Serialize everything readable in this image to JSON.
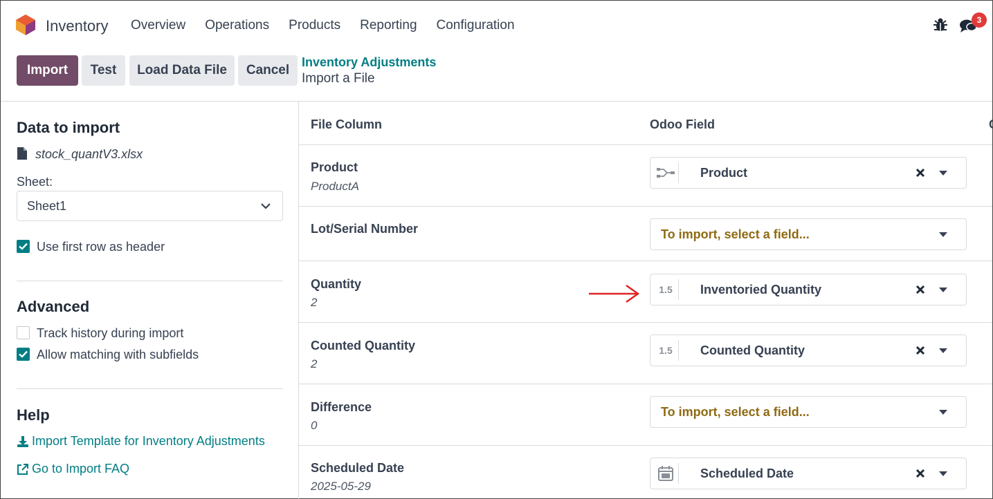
{
  "app": {
    "name": "Inventory",
    "menu": [
      "Overview",
      "Operations",
      "Products",
      "Reporting",
      "Configuration"
    ],
    "notifications": "3"
  },
  "actions": {
    "import": "Import",
    "test": "Test",
    "load": "Load Data File",
    "cancel": "Cancel"
  },
  "breadcrumb": {
    "parent": "Inventory Adjustments",
    "current": "Import a File"
  },
  "sidebar": {
    "data_title": "Data to import",
    "file_name": "stock_quantV3.xlsx",
    "sheet_label": "Sheet:",
    "sheet_value": "Sheet1",
    "header_option": "Use first row as header",
    "advanced_title": "Advanced",
    "track_history": "Track history during import",
    "allow_matching": "Allow matching with subfields",
    "help_title": "Help",
    "template_link": "Import Template for Inventory Adjustments",
    "faq_link": "Go to Import FAQ"
  },
  "table": {
    "col_file": "File Column",
    "col_odoo": "Odoo Field",
    "col_third": "C",
    "placeholder": "To import, select a field...",
    "rows": [
      {
        "name": "Product",
        "sample": "ProductA",
        "field": "Product",
        "icon": "relation-icon"
      },
      {
        "name": "Lot/Serial Number",
        "sample": "",
        "field": "",
        "icon": ""
      },
      {
        "name": "Quantity",
        "sample": "2",
        "field": "Inventoried Quantity",
        "icon": "decimal-icon",
        "icon_text": "1.5"
      },
      {
        "name": "Counted Quantity",
        "sample": "2",
        "field": "Counted Quantity",
        "icon": "decimal-icon",
        "icon_text": "1.5"
      },
      {
        "name": "Difference",
        "sample": "0",
        "field": "",
        "icon": ""
      },
      {
        "name": "Scheduled Date",
        "sample": "2025-05-29",
        "field": "Scheduled Date",
        "icon": "calendar-icon"
      }
    ]
  },
  "colors": {
    "primary": "#714b67",
    "accent": "#017e84",
    "placeholder": "#8f6a12",
    "annotation_arrow": "#e02424"
  }
}
